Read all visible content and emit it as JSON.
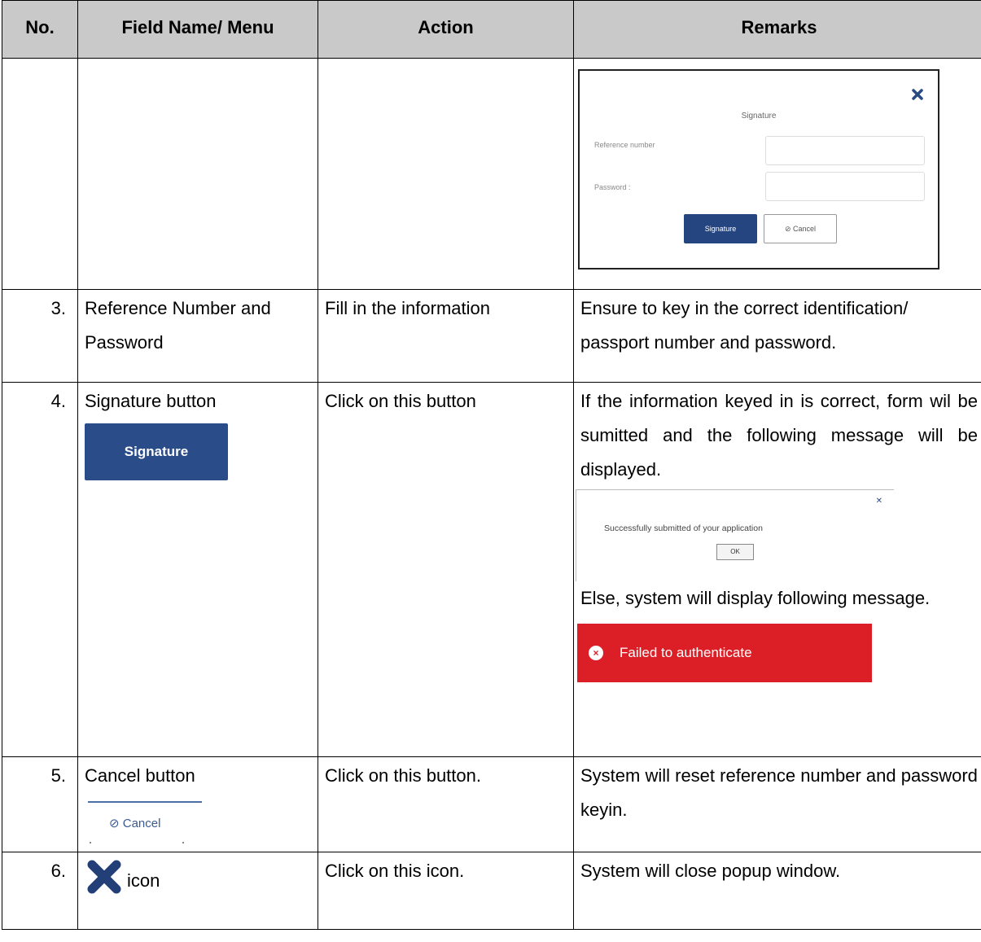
{
  "headers": {
    "no": "No.",
    "field": "Field Name/ Menu",
    "action": "Action",
    "remarks": "Remarks"
  },
  "signature_dialog": {
    "title": "Signature",
    "reference_label": "Reference number",
    "password_label": "Password :",
    "signature_button": "Signature",
    "cancel_button": "Cancel",
    "close_icon": "close-icon"
  },
  "rows": [
    {
      "no": "3.",
      "field": "Reference Number and Password",
      "action": "Fill in the information",
      "remarks": "Ensure to key in the correct identification/ passport number and password."
    },
    {
      "no": "4.",
      "field": "Signature button",
      "field_button": "Signature",
      "action": "Click on this button",
      "remarks_intro": "If the information keyed in is correct, form wil be sumitted and the following message will be displayed.",
      "success_message": "Successfully submitted of your application",
      "success_ok": "OK",
      "remarks_else": "Else, system will display following message.",
      "error_message": "Failed to authenticate"
    },
    {
      "no": "5.",
      "field": "Cancel button",
      "field_button": "Cancel",
      "action": "Click on this button.",
      "remarks": "System will reset reference number and password keyin."
    },
    {
      "no": "6.",
      "field_icon": "close-x-icon",
      "field": "icon",
      "action": "Click on this icon.",
      "remarks": "System will close popup window."
    }
  ],
  "colors": {
    "header_bg": "#c9c9c9",
    "primary_button": "#2a4d8a",
    "error_bg": "#dc1f26"
  }
}
